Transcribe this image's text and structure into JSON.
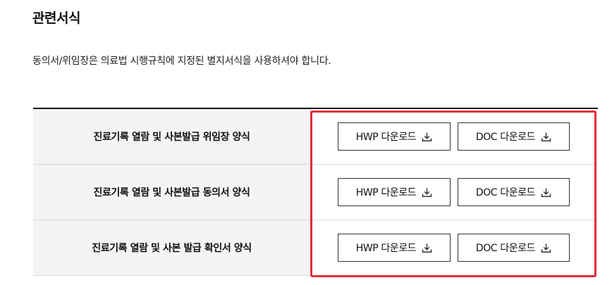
{
  "section": {
    "title": "관련서식",
    "notice": "동의서/위임장은 의료법 시행규칙에 지정된 별지서식을 사용하셔야 합니다."
  },
  "forms": [
    {
      "name": "진료기록 열람 및 사본발급 위임장 양식",
      "hwp_label": "HWP 다운로드",
      "doc_label": "DOC 다운로드"
    },
    {
      "name": "진료기록 열람 및 사본발급 동의서 양식",
      "hwp_label": "HWP 다운로드",
      "doc_label": "DOC 다운로드"
    },
    {
      "name": "진료기록 열람 및 사본 발급 확인서 양식",
      "hwp_label": "HWP 다운로드",
      "doc_label": "DOC 다운로드"
    }
  ],
  "icons": {
    "download": "download-icon"
  },
  "colors": {
    "highlight": "#e02f3a",
    "header_cell_bg": "#f4f4f4",
    "table_top_border": "#111111"
  }
}
